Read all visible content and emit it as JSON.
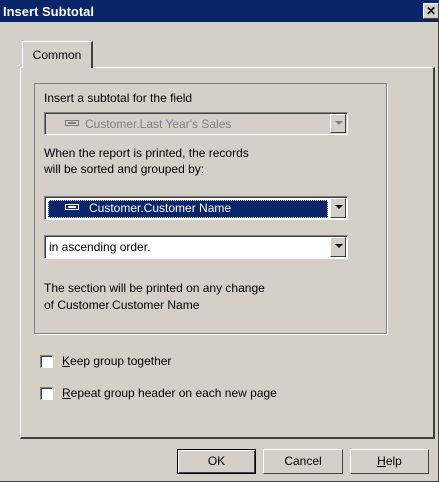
{
  "window": {
    "title": "Insert Subtotal",
    "close_glyph": "✕"
  },
  "tabs": [
    {
      "label": "Common",
      "selected": true
    }
  ],
  "field_section": {
    "label": "Insert a subtotal for the field",
    "field_value": "Customer.Last Year's Sales",
    "field_enabled": false
  },
  "sort_section": {
    "label_line1": "When the report is printed, the records",
    "label_line2": "will be sorted and grouped by:",
    "group_field_value": "Customer.Customer Name",
    "order_value": "in ascending order."
  },
  "change_section": {
    "line1": "The section will be printed on any change",
    "line2": "of  Customer.Customer Name"
  },
  "options": {
    "keep_together": {
      "accel": "K",
      "rest": "eep group together",
      "checked": false
    },
    "repeat_header": {
      "accel": "R",
      "rest": "epeat group header on each new page",
      "checked": false
    }
  },
  "buttons": {
    "ok": "OK",
    "cancel": "Cancel",
    "help_accel": "H",
    "help_rest": "elp"
  },
  "colors": {
    "title_bar": "#0a246a",
    "selection": "#0a246a",
    "face": "#d4d0c8"
  }
}
